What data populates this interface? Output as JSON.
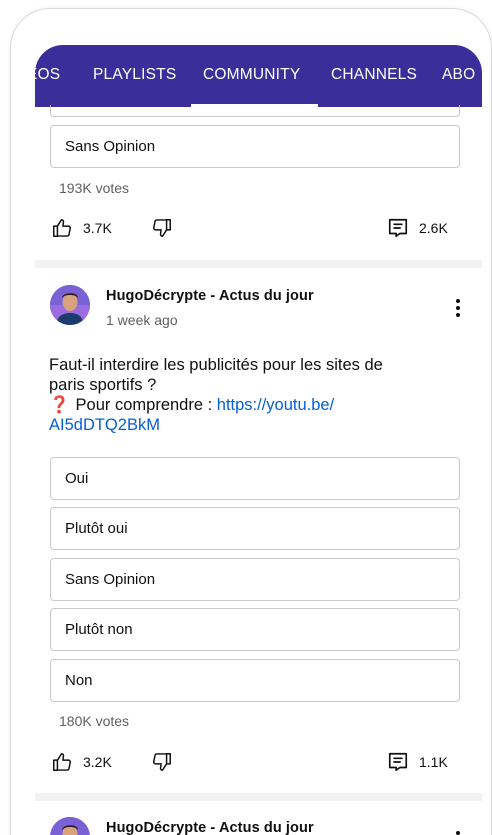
{
  "tabs": [
    {
      "label": "EOS",
      "active": false
    },
    {
      "label": "PLAYLISTS",
      "active": false
    },
    {
      "label": "COMMUNITY",
      "active": true
    },
    {
      "label": "CHANNELS",
      "active": false
    },
    {
      "label": "ABO",
      "active": false
    }
  ],
  "colors": {
    "tabbar_bg": "#3a2f9a",
    "link": "#065fd4",
    "qmark": "#cc1d1d"
  },
  "post1": {
    "options": [
      "Sans Opinion"
    ],
    "votes": "193K votes",
    "likes": "3.7K",
    "comments": "2.6K"
  },
  "post2": {
    "channel": "HugoDécrypte - Actus du jour",
    "time": "1 week ago",
    "text_line1": "Faut-il interdire les publicités pour les sites de",
    "text_line2": "paris sportifs ?",
    "qmark": "❓",
    "text_prefix": "Pour comprendre : ",
    "link_part1": "https://youtu.be/",
    "link_part2": "AI5dDTQ2BkM",
    "options": [
      "Oui",
      "Plutôt oui",
      "Sans Opinion",
      "Plutôt non",
      "Non"
    ],
    "votes": "180K votes",
    "likes": "3.2K",
    "comments": "1.1K"
  },
  "post3": {
    "channel": "HugoDécrypte - Actus du jour"
  },
  "icons": {
    "like": "thumbs-up-icon",
    "dislike": "thumbs-down-icon",
    "comment": "comment-icon",
    "menu": "more-vert-icon"
  }
}
